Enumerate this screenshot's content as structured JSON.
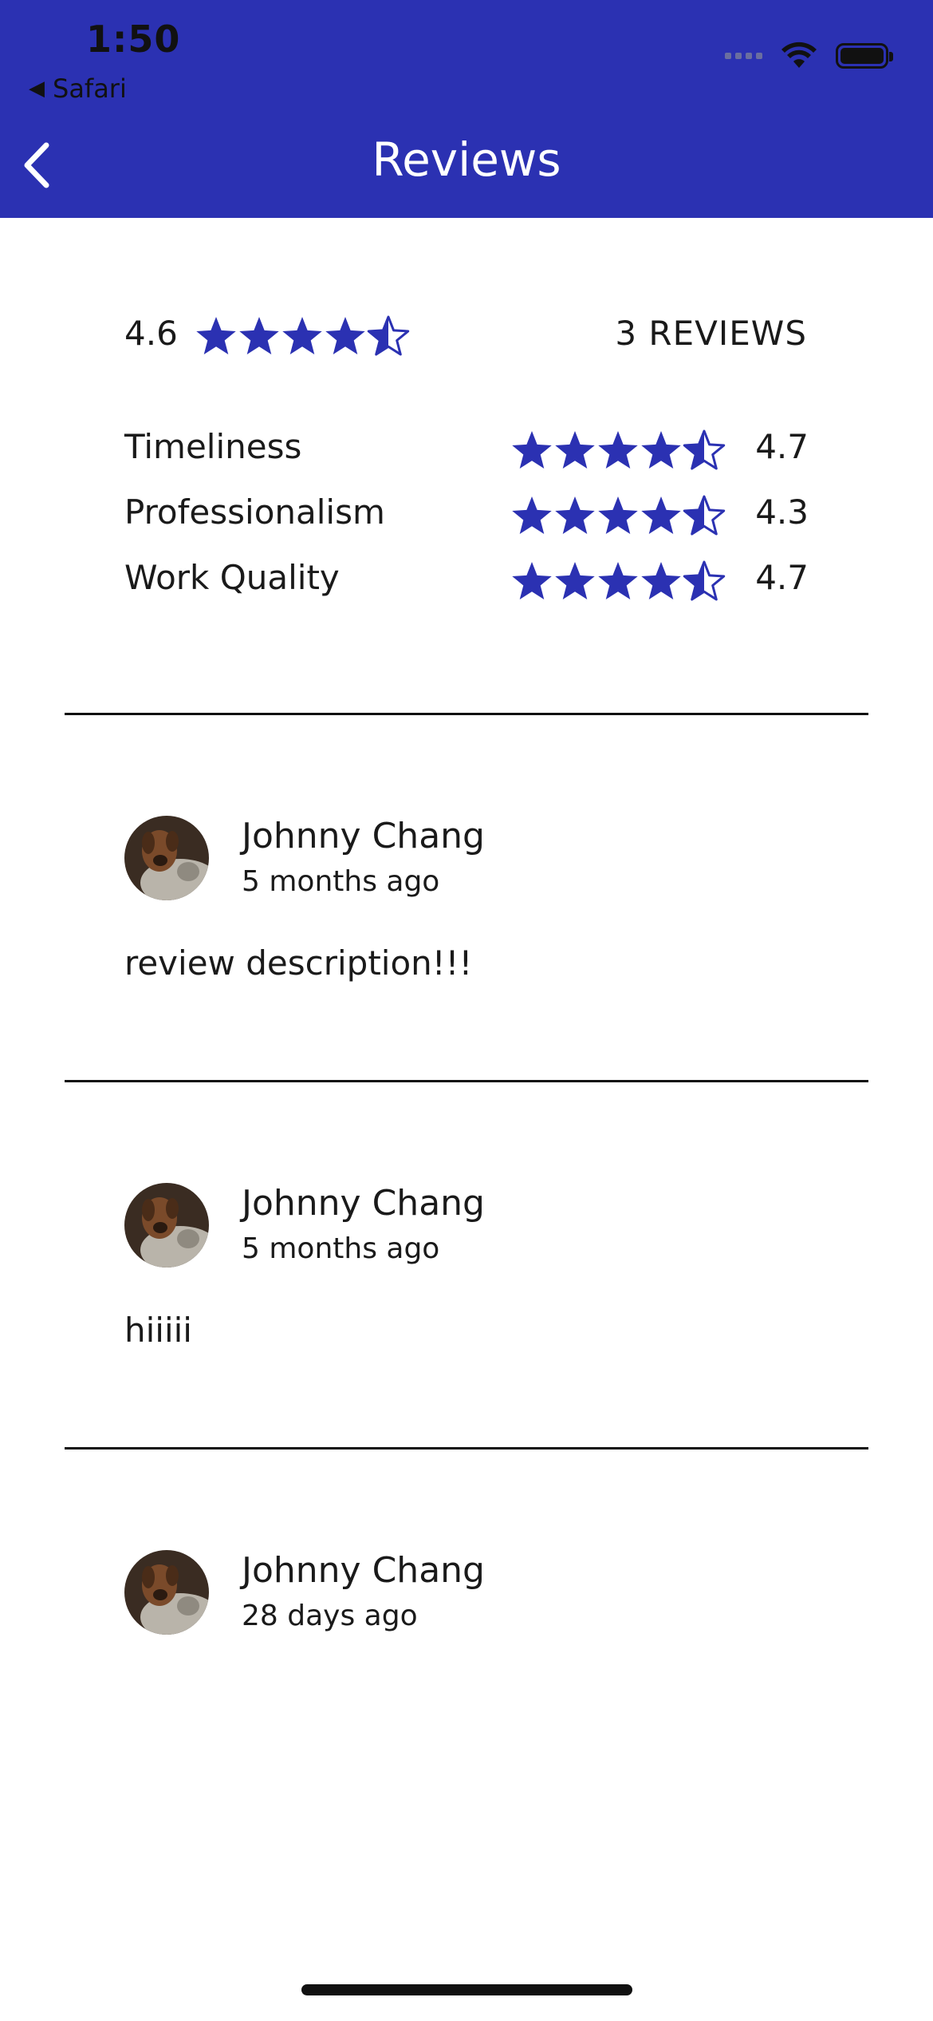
{
  "status_bar": {
    "time": "1:50",
    "back_app": "Safari",
    "back_arrow_icon": "small-left-triangle-icon",
    "wifi_icon": "wifi-icon",
    "battery_icon": "battery-icon",
    "signal_icon": "cellular-signal-icon"
  },
  "nav": {
    "title": "Reviews",
    "back_icon": "chevron-left-icon",
    "color": "#2b31b2"
  },
  "summary": {
    "score": "4.6",
    "rating": 4.6,
    "count_label": "3 REVIEWS"
  },
  "categories": [
    {
      "label": "Timeliness",
      "score": "4.7",
      "rating": 4.7
    },
    {
      "label": "Professionalism",
      "score": "4.3",
      "rating": 4.3
    },
    {
      "label": "Work Quality",
      "score": "4.7",
      "rating": 4.7
    }
  ],
  "reviews": [
    {
      "name": "Johnny Chang",
      "time": "5 months ago",
      "text": "review description!!!"
    },
    {
      "name": "Johnny Chang",
      "time": "5 months ago",
      "text": "hiiiii"
    },
    {
      "name": "Johnny Chang",
      "time": "28 days ago",
      "text": ""
    }
  ],
  "star_color": "#2b31b2"
}
